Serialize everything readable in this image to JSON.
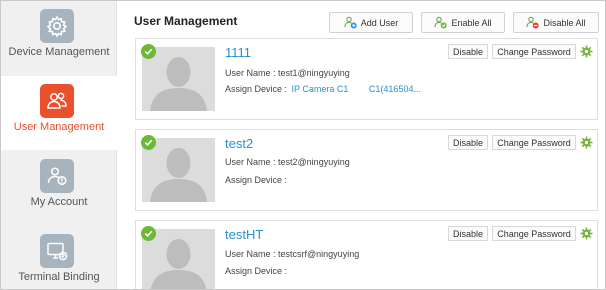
{
  "sidebar": {
    "items": [
      {
        "label": "Device Management",
        "icon": "gear-icon"
      },
      {
        "label": "User Management",
        "icon": "users-icon",
        "active": true
      },
      {
        "label": "My Account",
        "icon": "account-icon"
      },
      {
        "label": "Terminal Binding",
        "icon": "monitor-check-icon"
      }
    ]
  },
  "header": {
    "title": "User Management",
    "add_user_label": "Add User",
    "enable_all_label": "Enable All",
    "disable_all_label": "Disable All"
  },
  "labels": {
    "user_name": "User Name :",
    "assign_device": "Assign Device :",
    "disable": "Disable",
    "change_password": "Change Password"
  },
  "users": [
    {
      "name": "1111",
      "username": "test1@ningyuying",
      "devices": [
        "IP Camera C1",
        "C1(416504..."
      ]
    },
    {
      "name": "test2",
      "username": "test2@ningyuying",
      "devices": []
    },
    {
      "name": "testHT",
      "username": "testcsrf@ningyuying",
      "devices": []
    }
  ],
  "colors": {
    "accent": "#e8512c",
    "link": "#2a8fd0",
    "status_ok": "#6bb934",
    "gear_green": "#7cb342"
  }
}
